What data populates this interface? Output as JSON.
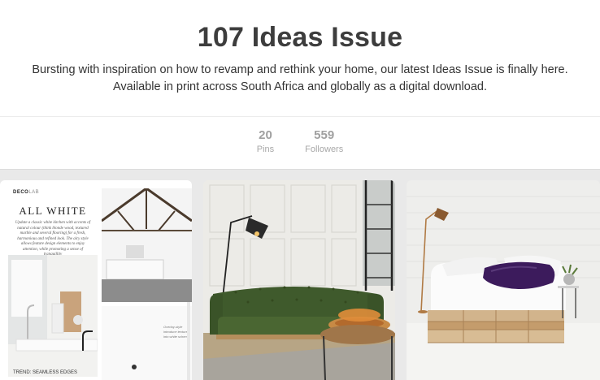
{
  "board": {
    "title": "107 Ideas Issue",
    "description_line1": "Bursting with inspiration on how to revamp and rethink your home, our latest Ideas Issue is finally here.",
    "description_line2": "Available in print across South Africa and globally as a digital download."
  },
  "stats": {
    "pins_count": "20",
    "pins_label": "Pins",
    "followers_count": "559",
    "followers_label": "Followers"
  },
  "pins": [
    {
      "brand": "DECO",
      "brand_suffix": "LAB",
      "heading": "ALL WHITE",
      "body": "Update a classic white kitchen with accents of natural colour (think blonde wood, textured marble and several flooring) for a fresh, harmonious and refined look. The airy style allows feature design elements to enjoy attention, while promoting a sense of tranquillity",
      "trend": "TREND: SEAMLESS EDGES"
    },
    {},
    {}
  ],
  "colors": {
    "title": "#3d3d3d",
    "stat_text": "#a0a0a0",
    "grid_background": "#e9e9e9",
    "sofa_green": "#3f5a2c",
    "throw_purple": "#3c1b5c",
    "copper_lamp": "#b07a44"
  }
}
